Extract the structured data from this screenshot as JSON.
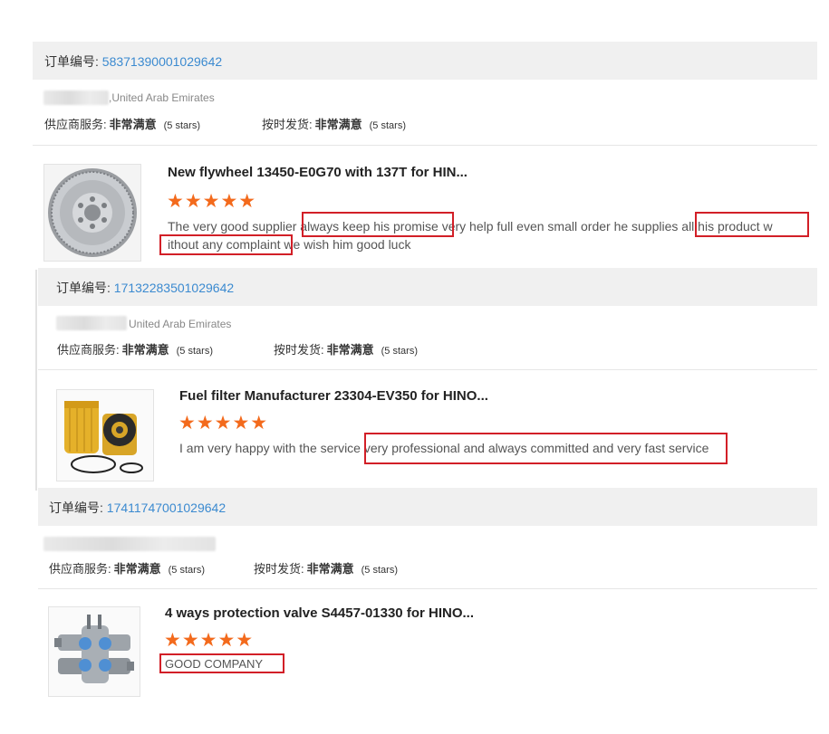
{
  "order_label": "订单编号:",
  "orders": [
    {
      "order_number": "58371390001029642",
      "country": "United Arab Emirates",
      "country_prefix": ",",
      "supplier_service_label": "供应商服务:",
      "supplier_service_value": "非常满意",
      "supplier_service_stars": "(5 stars)",
      "ontime_label": "按时发货:",
      "ontime_value": "非常满意",
      "ontime_stars": "(5 stars)",
      "product_title": "New flywheel 13450-E0G70 with 137T for HIN...",
      "rating_stars": "★★★★★",
      "review_line1": "The very good supplier always keep his promise very help full even small order he supplies all his product w",
      "review_line2": "ithout any complaint we wish him good luck",
      "image_icon": "flywheel-image"
    },
    {
      "order_number": "17132283501029642",
      "country": "United Arab Emirates",
      "supplier_service_label": "供应商服务:",
      "supplier_service_value": "非常满意",
      "supplier_service_stars": "(5 stars)",
      "ontime_label": "按时发货:",
      "ontime_value": "非常满意",
      "ontime_stars": "(5 stars)",
      "product_title": "Fuel filter Manufacturer 23304-EV350 for HINO...",
      "rating_stars": "★★★★★",
      "review_line1": "I am very happy with the service very professional and always committed and very fast service",
      "image_icon": "fuel-filter-image"
    },
    {
      "order_number": "17411747001029642",
      "supplier_service_label": "供应商服务:",
      "supplier_service_value": "非常满意",
      "supplier_service_stars": "(5 stars)",
      "ontime_label": "按时发货:",
      "ontime_value": "非常满意",
      "ontime_stars": "(5 stars)",
      "product_title": "4 ways protection valve S4457-01330 for HINO...",
      "rating_stars": "★★★★★",
      "review_line1": "GOOD COMPANY",
      "image_icon": "protection-valve-image"
    }
  ],
  "colors": {
    "header_bg": "#f0f0f0",
    "order_number": "#3b8ad0",
    "star": "#f36a1c",
    "highlight_box": "#d21f27"
  }
}
